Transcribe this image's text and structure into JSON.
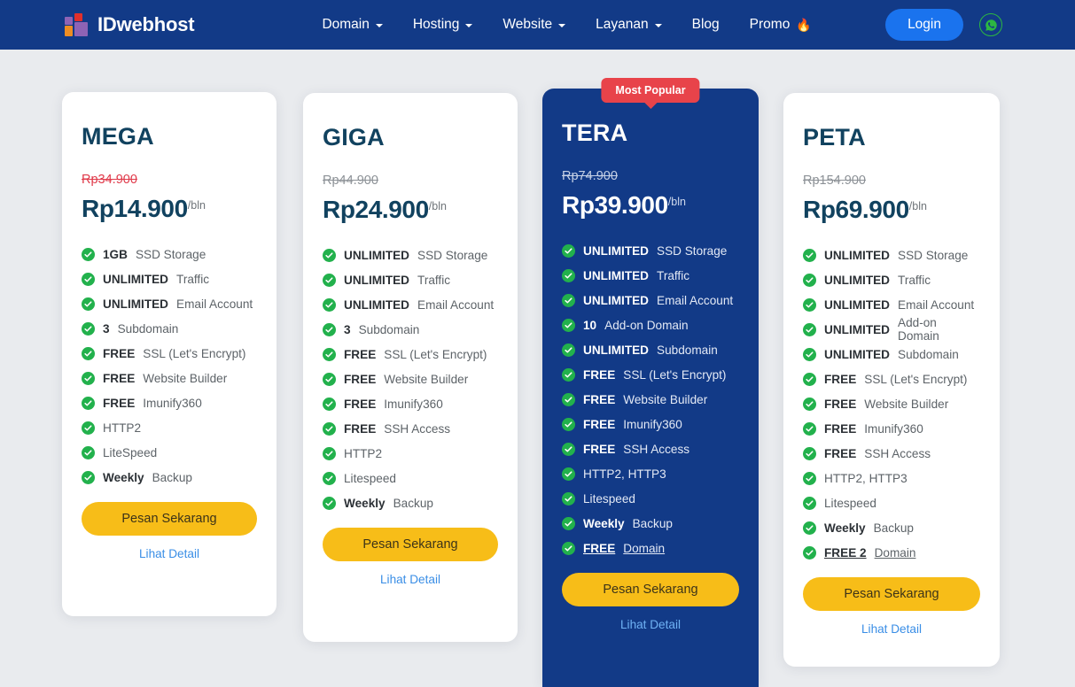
{
  "header": {
    "logo_text": "IDwebhost",
    "nav": [
      {
        "label": "Domain",
        "has_caret": true
      },
      {
        "label": "Hosting",
        "has_caret": true
      },
      {
        "label": "Website",
        "has_caret": true
      },
      {
        "label": "Layanan",
        "has_caret": true
      },
      {
        "label": "Blog",
        "has_caret": false
      },
      {
        "label": "Promo",
        "has_caret": false,
        "emoji": "🔥"
      }
    ],
    "login_label": "Login",
    "whatsapp_icon": "whatsapp-icon",
    "background_color": "#123a87",
    "login_color": "#1a73ee"
  },
  "badge": {
    "label": "Most Popular",
    "color": "#e8434a"
  },
  "labels": {
    "order": "Pesan Sekarang",
    "detail": "Lihat Detail",
    "unit": "/bln"
  },
  "plans": [
    {
      "name": "MEGA",
      "price_old": "Rp34.900",
      "price_now": "Rp14.900",
      "old_accent": true,
      "highlight": false,
      "features": [
        {
          "strong": "1GB",
          "rest": " SSD Storage"
        },
        {
          "strong": "UNLIMITED",
          "rest": " Traffic"
        },
        {
          "strong": "UNLIMITED",
          "rest": " Email Account"
        },
        {
          "strong": "3",
          "rest": " Subdomain"
        },
        {
          "strong": "FREE",
          "rest": " SSL (Let's Encrypt)"
        },
        {
          "strong": "FREE",
          "rest": " Website Builder"
        },
        {
          "strong": "FREE",
          "rest": " Imunify360"
        },
        {
          "strong": "",
          "rest": "HTTP2"
        },
        {
          "strong": "",
          "rest": "LiteSpeed"
        },
        {
          "strong": "Weekly",
          "rest": " Backup"
        }
      ]
    },
    {
      "name": "GIGA",
      "price_old": "Rp44.900",
      "price_now": "Rp24.900",
      "old_accent": false,
      "highlight": false,
      "features": [
        {
          "strong": "UNLIMITED",
          "rest": " SSD Storage"
        },
        {
          "strong": "UNLIMITED",
          "rest": " Traffic"
        },
        {
          "strong": "UNLIMITED",
          "rest": " Email Account"
        },
        {
          "strong": "3",
          "rest": " Subdomain"
        },
        {
          "strong": "FREE",
          "rest": " SSL (Let's Encrypt)"
        },
        {
          "strong": "FREE",
          "rest": " Website Builder"
        },
        {
          "strong": "FREE",
          "rest": " Imunify360"
        },
        {
          "strong": "FREE",
          "rest": " SSH Access"
        },
        {
          "strong": "",
          "rest": "HTTP2"
        },
        {
          "strong": "",
          "rest": "Litespeed"
        },
        {
          "strong": "Weekly",
          "rest": " Backup"
        }
      ]
    },
    {
      "name": "TERA",
      "price_old": "Rp74.900",
      "price_now": "Rp39.900",
      "old_accent": false,
      "highlight": true,
      "features": [
        {
          "strong": "UNLIMITED",
          "rest": " SSD Storage"
        },
        {
          "strong": "UNLIMITED",
          "rest": " Traffic"
        },
        {
          "strong": "UNLIMITED",
          "rest": " Email Account"
        },
        {
          "strong": "10",
          "rest": " Add-on Domain"
        },
        {
          "strong": "UNLIMITED",
          "rest": " Subdomain"
        },
        {
          "strong": "FREE",
          "rest": " SSL (Let's Encrypt)"
        },
        {
          "strong": "FREE",
          "rest": " Website Builder"
        },
        {
          "strong": "FREE",
          "rest": " Imunify360"
        },
        {
          "strong": "FREE",
          "rest": " SSH Access"
        },
        {
          "strong": "",
          "rest": "HTTP2, HTTP3"
        },
        {
          "strong": "",
          "rest": "Litespeed"
        },
        {
          "strong": "Weekly",
          "rest": " Backup"
        },
        {
          "strong": "FREE",
          "rest": " Domain",
          "underline": true
        }
      ]
    },
    {
      "name": "PETA",
      "price_old": "Rp154.900",
      "price_now": "Rp69.900",
      "old_accent": false,
      "highlight": false,
      "features": [
        {
          "strong": "UNLIMITED",
          "rest": " SSD Storage"
        },
        {
          "strong": "UNLIMITED",
          "rest": " Traffic"
        },
        {
          "strong": "UNLIMITED",
          "rest": " Email Account"
        },
        {
          "strong": "UNLIMITED",
          "rest": " Add-on Domain"
        },
        {
          "strong": "UNLIMITED",
          "rest": " Subdomain"
        },
        {
          "strong": "FREE",
          "rest": " SSL (Let's Encrypt)"
        },
        {
          "strong": "FREE",
          "rest": " Website Builder"
        },
        {
          "strong": "FREE",
          "rest": " Imunify360"
        },
        {
          "strong": "FREE",
          "rest": " SSH Access"
        },
        {
          "strong": "",
          "rest": "HTTP2, HTTP3"
        },
        {
          "strong": "",
          "rest": "Litespeed"
        },
        {
          "strong": "Weekly",
          "rest": " Backup"
        },
        {
          "strong": "FREE 2",
          "rest": " Domain",
          "underline": true
        }
      ]
    }
  ]
}
